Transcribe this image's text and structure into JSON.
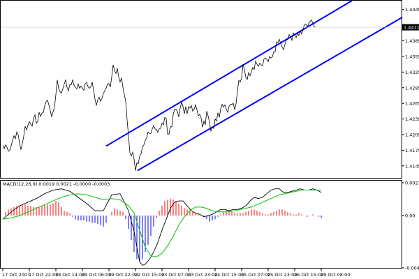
{
  "chart_data": {
    "type": "line",
    "colors": {
      "background": "#ffffff",
      "price_line": "#000000",
      "channel": "#0000ff",
      "macd_line": "#000000",
      "signal_line": "#00c800",
      "hist_positive": "#ff0000",
      "hist_negative": "#0000ff",
      "current_price_tag": "#000000",
      "current_price_text": "#ffffff"
    },
    "price_panel": {
      "ylim": [
        1.4122,
        1.4462
      ],
      "yticks": [
        "1.4445",
        "1.4411",
        "1.4385",
        "1.4355",
        "1.4325",
        "1.4295",
        "1.4265",
        "1.4235",
        "1.4205",
        "1.4175",
        "1.4145"
      ],
      "current_price": "1.4411",
      "current_price_value": 1.4411,
      "series": [
        {
          "x": [
            0,
            2,
            4,
            6,
            8,
            10,
            12,
            14,
            16,
            18,
            20,
            22,
            24,
            26,
            28,
            30,
            32,
            34,
            36,
            38,
            40,
            42,
            44,
            46,
            48,
            50,
            52,
            54,
            56,
            58,
            60,
            62,
            64,
            66,
            68,
            70,
            72,
            74,
            76,
            78,
            80,
            82,
            84,
            86,
            88,
            90,
            92,
            94,
            96,
            98,
            100,
            102,
            104,
            106,
            108,
            110,
            112,
            114,
            116,
            118,
            120,
            122,
            124,
            126,
            128,
            130,
            132,
            134,
            136,
            138,
            140,
            142,
            144,
            146,
            148,
            150,
            152,
            154,
            156,
            158,
            160,
            162,
            164,
            166,
            168,
            170,
            172,
            174,
            176,
            178,
            180,
            182,
            184,
            186,
            188,
            190,
            192,
            194,
            196,
            198,
            200,
            202,
            204,
            206,
            208,
            210,
            212,
            214,
            216,
            218,
            220,
            222,
            224,
            226,
            228,
            230,
            232,
            234,
            236,
            238,
            240,
            242,
            244,
            246,
            248,
            250,
            252,
            254,
            256,
            258,
            260,
            262,
            264,
            266,
            268,
            270,
            272,
            274,
            276,
            278,
            280,
            282,
            284,
            286,
            288,
            290,
            292,
            294,
            296,
            298,
            300,
            302,
            304,
            306,
            308,
            310,
            312,
            314,
            316,
            318,
            320,
            322,
            324,
            326,
            328,
            330,
            332,
            334,
            336,
            338,
            340,
            342,
            344,
            346,
            348,
            350,
            352,
            354,
            356,
            358,
            360,
            362,
            364,
            366,
            368,
            370,
            372,
            374,
            376,
            378,
            380,
            382,
            384,
            386,
            388,
            390,
            392,
            394,
            396,
            398,
            400,
            402,
            404,
            406,
            408,
            410,
            412,
            414,
            416,
            418,
            420,
            422,
            424,
            426,
            428,
            430,
            432,
            434,
            436,
            438,
            440,
            442,
            444,
            446,
            448,
            450,
            452,
            454,
            456,
            458
          ],
          "y": [
            1.4184,
            1.4178,
            1.4185,
            1.4181,
            1.4173,
            1.4175,
            1.4183,
            1.4194,
            1.4203,
            1.4197,
            1.421,
            1.4205,
            1.4189,
            1.4176,
            1.4188,
            1.4202,
            1.4221,
            1.4214,
            1.4223,
            1.423,
            1.4225,
            1.4221,
            1.4236,
            1.4243,
            1.4227,
            1.423,
            1.4248,
            1.424,
            1.4246,
            1.4248,
            1.426,
            1.4268,
            1.4271,
            1.4262,
            1.4251,
            1.4239,
            1.4249,
            1.4257,
            1.4282,
            1.431,
            1.4293,
            1.4287,
            1.4285,
            1.4293,
            1.4302,
            1.431,
            1.4296,
            1.4289,
            1.4301,
            1.4301,
            1.431,
            1.43,
            1.4296,
            1.4293,
            1.4302,
            1.4294,
            1.4298,
            1.4294,
            1.429,
            1.4303,
            1.4305,
            1.4297,
            1.4294,
            1.4297,
            1.4306,
            1.429,
            1.4273,
            1.4261,
            1.4272,
            1.4277,
            1.4269,
            1.4275,
            1.4284,
            1.4289,
            1.4294,
            1.4302,
            1.4303,
            1.4296,
            1.4316,
            1.4339,
            1.4328,
            1.4322,
            1.4332,
            1.4316,
            1.4306,
            1.4314,
            1.4296,
            1.4282,
            1.4269,
            1.4233,
            1.4203,
            1.417,
            1.4164,
            1.4171,
            1.4158,
            1.4136,
            1.4151,
            1.4149,
            1.4164,
            1.4168,
            1.4182,
            1.4185,
            1.4194,
            1.4199,
            1.421,
            1.4207,
            1.4207,
            1.4216,
            1.4222,
            1.4216,
            1.4215,
            1.4209,
            1.4216,
            1.4217,
            1.4227,
            1.4224,
            1.4238,
            1.4236,
            1.4206,
            1.4206,
            1.422,
            1.422,
            1.4243,
            1.4254,
            1.4254,
            1.4249,
            1.4239,
            1.4256,
            1.4267,
            1.4259,
            1.4245,
            1.4259,
            1.4245,
            1.4259,
            1.4256,
            1.4261,
            1.425,
            1.4253,
            1.4262,
            1.4253,
            1.4241,
            1.4244,
            1.4237,
            1.4219,
            1.4231,
            1.4224,
            1.425,
            1.4241,
            1.4228,
            1.4212,
            1.4219,
            1.4217,
            1.4235,
            1.4231,
            1.4247,
            1.4238,
            1.4254,
            1.4263,
            1.4258,
            1.4262,
            1.4254,
            1.4248,
            1.4259,
            1.4263,
            1.4263,
            1.4265,
            1.4253,
            1.4264,
            1.4289,
            1.4309,
            1.4306,
            1.4314,
            1.434,
            1.4329,
            1.4315,
            1.4311,
            1.4324,
            1.4318,
            1.4326,
            1.4334,
            1.433,
            1.4346,
            1.434,
            1.4336,
            1.4342,
            1.4339,
            1.4337,
            1.435,
            1.4352,
            1.4349,
            1.4345,
            1.4355,
            1.4352,
            1.4354,
            1.4364,
            1.4364,
            1.4383,
            1.4382,
            1.4388,
            1.438,
            1.4373,
            1.4368,
            1.4378,
            1.4387,
            1.4388,
            1.4397,
            1.4393,
            1.4386,
            1.44,
            1.4397,
            1.4391,
            1.4399,
            1.4395,
            1.4404,
            1.4398,
            1.4408,
            1.4416,
            1.4417,
            1.4412,
            1.4418,
            1.4422,
            1.4425,
            1.4419,
            1.4412,
            1.4411
          ]
        }
      ],
      "channel_lines": [
        {
          "x": [
            148,
            500
          ],
          "y": [
            1.4183,
            1.4462
          ]
        },
        {
          "x": [
            193,
            572
          ],
          "y": [
            1.4136,
            1.443
          ]
        }
      ]
    },
    "macd_panel": {
      "label": "MACD(12,26,9) 0.0019 0.0021 -0.0000 -0.0003",
      "ylim": [
        -0.0043,
        0.0027
      ],
      "yticks": [
        "0.0027",
        "0.00",
        "-0.0043"
      ],
      "macd_x": [
        0,
        12,
        24,
        36,
        48,
        60,
        72,
        84,
        96,
        108,
        120,
        132,
        144,
        156,
        168,
        180,
        188,
        192,
        196,
        200,
        204,
        210,
        216,
        222,
        228,
        234,
        240,
        246,
        252,
        258,
        264,
        270,
        276,
        282,
        288,
        294,
        300,
        306,
        312,
        318,
        324,
        330,
        336,
        342,
        348,
        354,
        360,
        366,
        372,
        378,
        384,
        390,
        396,
        402,
        408,
        414,
        420,
        426,
        432,
        438,
        444,
        450,
        456
      ],
      "macd_y": [
        -0.0003,
        0.0003,
        0.0008,
        0.0011,
        0.0014,
        0.0018,
        0.0021,
        0.0022,
        0.002,
        0.0015,
        0.001,
        0.0004,
        0.0004,
        0.0017,
        0.0018,
        0.0004,
        -0.0013,
        -0.0026,
        -0.0038,
        -0.0041,
        -0.004,
        -0.0036,
        -0.003,
        -0.0022,
        -0.0012,
        -0.0003,
        0.0006,
        0.0011,
        0.0012,
        0.0012,
        0.0008,
        0.0004,
        0.0002,
        0.0001,
        -0.0001,
        0.0,
        0.0001,
        0.0003,
        0.0005,
        0.0005,
        0.0004,
        0.0005,
        0.0005,
        0.0006,
        0.0008,
        0.0012,
        0.0015,
        0.0014,
        0.0015,
        0.0018,
        0.0021,
        0.0022,
        0.0022,
        0.0019,
        0.0019,
        0.002,
        0.0021,
        0.0022,
        0.0021,
        0.0021,
        0.0022,
        0.0021,
        0.0019
      ],
      "signal_x": [
        0,
        12,
        24,
        36,
        48,
        60,
        72,
        84,
        96,
        108,
        120,
        132,
        144,
        156,
        168,
        180,
        188,
        196,
        204,
        212,
        220,
        228,
        236,
        244,
        252,
        260,
        268,
        276,
        284,
        292,
        300,
        308,
        316,
        324,
        332,
        340,
        348,
        356,
        364,
        372,
        380,
        388,
        396,
        404,
        412,
        420,
        428,
        436,
        444,
        450,
        456
      ],
      "signal_y": [
        -0.0003,
        -0.0002,
        0.0,
        0.0003,
        0.0006,
        0.0009,
        0.0012,
        0.0015,
        0.0017,
        0.0018,
        0.0017,
        0.0015,
        0.0013,
        0.0014,
        0.0013,
        0.0008,
        0.0002,
        -0.0012,
        -0.0026,
        -0.0033,
        -0.0034,
        -0.0031,
        -0.0025,
        -0.0017,
        -0.0008,
        -0.0001,
        0.0004,
        0.0007,
        0.0007,
        0.0006,
        0.0004,
        0.0003,
        0.0003,
        0.0003,
        0.0004,
        0.0005,
        0.0006,
        0.0007,
        0.0009,
        0.0011,
        0.0013,
        0.0015,
        0.0017,
        0.0018,
        0.0019,
        0.002,
        0.0021,
        0.0021,
        0.0021,
        0.0021,
        0.0021
      ],
      "hist_x": [
        4,
        8,
        12,
        16,
        20,
        24,
        28,
        32,
        36,
        40,
        44,
        48,
        52,
        56,
        60,
        64,
        68,
        72,
        76,
        80,
        84,
        88,
        92,
        96,
        100,
        104,
        108,
        112,
        116,
        120,
        124,
        128,
        132,
        136,
        140,
        144,
        148,
        152,
        156,
        160,
        164,
        168,
        172,
        176,
        180,
        184,
        188,
        192,
        196,
        200,
        204,
        208,
        212,
        216,
        220,
        224,
        228,
        232,
        236,
        240,
        244,
        248,
        252,
        256,
        260,
        264,
        268,
        272,
        276,
        280,
        284,
        288,
        292,
        296,
        300,
        304,
        308,
        312,
        316,
        320,
        324,
        328,
        332,
        336,
        340,
        344,
        348,
        352,
        356,
        360,
        364,
        368,
        372,
        376,
        380,
        384,
        388,
        392,
        396,
        400,
        404,
        408,
        412,
        416,
        420,
        424,
        428,
        432,
        436,
        440,
        444,
        448,
        452,
        456
      ],
      "hist_y": [
        0.0003,
        0.0005,
        0.0006,
        0.0007,
        0.0008,
        0.0008,
        0.0009,
        0.0009,
        0.0008,
        0.0008,
        0.0007,
        0.0007,
        0.0007,
        0.0008,
        0.0009,
        0.0009,
        0.0009,
        0.001,
        0.0012,
        0.0011,
        0.0007,
        0.0004,
        0.0003,
        0.0002,
        -0.0001,
        -0.0003,
        -0.0004,
        -0.0004,
        -0.0004,
        -0.0005,
        -0.0005,
        -0.0006,
        -0.0006,
        -0.0007,
        -0.0008,
        -0.0009,
        -0.0006,
        0.0,
        0.0003,
        0.0006,
        0.0005,
        0.0004,
        0.0003,
        -0.0003,
        -0.0011,
        -0.002,
        -0.003,
        -0.0036,
        -0.0038,
        -0.0036,
        -0.003,
        -0.0024,
        -0.0017,
        -0.0009,
        -0.0002,
        0.0004,
        0.0008,
        0.0012,
        0.0013,
        0.0014,
        0.0013,
        0.0012,
        0.001,
        0.0008,
        0.0006,
        0.0005,
        0.0004,
        0.0003,
        0.0002,
        0.0001,
        0.0,
        -0.0001,
        -0.0003,
        -0.0005,
        -0.0004,
        -0.0003,
        -0.0001,
        0.0001,
        0.0003,
        0.0004,
        0.0004,
        0.0003,
        0.0002,
        0.0002,
        0.0002,
        0.0002,
        0.0003,
        0.0004,
        0.0005,
        0.0005,
        0.0004,
        0.0003,
        0.0002,
        0.0001,
        0.0001,
        0.0002,
        0.0003,
        0.0004,
        0.0005,
        0.0005,
        0.0004,
        0.0003,
        0.0002,
        0.0001,
        0.0001,
        0.0002,
        0.0001,
        0.0,
        -0.0001,
        0.0,
        0.0001,
        0.0,
        -0.0001,
        -0.0002
      ]
    },
    "xaxis": {
      "ticks": [
        "17 Oct 2007",
        "17 Oct 22:00",
        "18 Oct 14:00",
        "19 Oct 06:00",
        "19 Oct 22:00",
        "22 Oct 15:00",
        "23 Oct 07:00",
        "23 Oct 23:00",
        "24 Oct 15:00",
        "25 Oct 07:00",
        "25 Oct 23:00",
        "26 Oct 15:00",
        "29 Oct 08:00"
      ],
      "tick_x": [
        0,
        38,
        76,
        114,
        152,
        190,
        228,
        266,
        304,
        342,
        380,
        418,
        456
      ]
    }
  }
}
